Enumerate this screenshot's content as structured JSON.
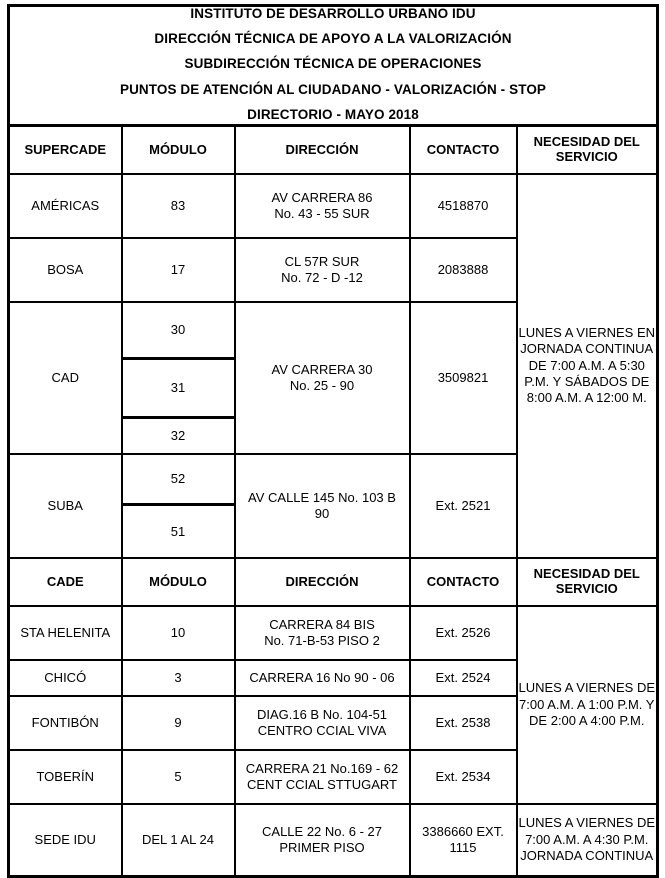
{
  "document": {
    "title_lines": [
      "INSTITUTO DE DESARROLLO URBANO IDU",
      "DIRECCIÓN TÉCNICA DE APOYO A LA VALORIZACIÓN",
      "SUBDIRECCIÓN TÉCNICA DE OPERACIONES",
      "PUNTOS DE ATENCIÓN AL CIUDADANO - VALORIZACIÓN - STOP",
      "DIRECTORIO - MAYO 2018"
    ]
  },
  "table": {
    "headers_supercade": {
      "col1": "SUPERCADE",
      "col2": "MÓDULO",
      "col3": "DIRECCIÓN",
      "col4": "CONTACTO",
      "col5": "NECESIDAD DEL SERVICIO"
    },
    "headers_cade": {
      "col1": "CADE",
      "col2": "MÓDULO",
      "col3": "DIRECCIÓN",
      "col4": "CONTACTO",
      "col5": "NECESIDAD DEL SERVICIO"
    },
    "supercade_rows": [
      {
        "name": "AMÉRICAS",
        "modules": [
          "83"
        ],
        "address_line1": "AV CARRERA 86",
        "address_line2": "No. 43 - 55 SUR",
        "contact": "4518870"
      },
      {
        "name": "BOSA",
        "modules": [
          "17"
        ],
        "address_line1": "CL 57R SUR",
        "address_line2": "No. 72 - D -12",
        "contact": "2083888"
      },
      {
        "name": "CAD",
        "modules": [
          "30",
          "31",
          "32"
        ],
        "address_line1": "AV CARRERA 30",
        "address_line2": "No. 25 - 90",
        "contact": "3509821"
      },
      {
        "name": "SUBA",
        "modules": [
          "52",
          "51"
        ],
        "address_line1": "AV CALLE 145 No. 103 B",
        "address_line2": "90",
        "contact": "Ext. 2521"
      }
    ],
    "supercade_service": "LUNES A VIERNES EN JORNADA CONTINUA DE 7:00 A.M. A 5:30 P.M. Y SÁBADOS DE 8:00 A.M. A 12:00 M.",
    "cade_rows": [
      {
        "name": "STA HELENITA",
        "module": "10",
        "address_line1": "CARRERA 84 BIS",
        "address_line2": "No. 71-B-53 PISO 2",
        "contact": "Ext. 2526"
      },
      {
        "name": "CHICÓ",
        "module": "3",
        "address_line1": "CARRERA 16 No 90 - 06",
        "address_line2": "",
        "contact": "Ext. 2524"
      },
      {
        "name": "FONTIBÓN",
        "module": "9",
        "address_line1": "DIAG.16 B No. 104-51",
        "address_line2": "CENTRO CCIAL VIVA",
        "contact": "Ext. 2538"
      },
      {
        "name": "TOBERÍN",
        "module": "5",
        "address_line1": "CARRERA 21 No.169 - 62",
        "address_line2": "CENT CCIAL STTUGART",
        "contact": "Ext. 2534"
      }
    ],
    "cade_service": "LUNES A VIERNES DE 7:00 A.M. A 1:00 P.M. Y DE 2:00 A 4:00 P.M.",
    "sede_row": {
      "name": "SEDE IDU",
      "module": "DEL 1 AL 24",
      "address_line1": "CALLE 22 No. 6 - 27",
      "address_line2": "PRIMER PISO",
      "contact_line1": "3386660 EXT.",
      "contact_line2": "1115",
      "service": "LUNES A VIERNES DE 7:00 A.M. A 4:30 P.M. JORNADA CONTINUA"
    }
  }
}
